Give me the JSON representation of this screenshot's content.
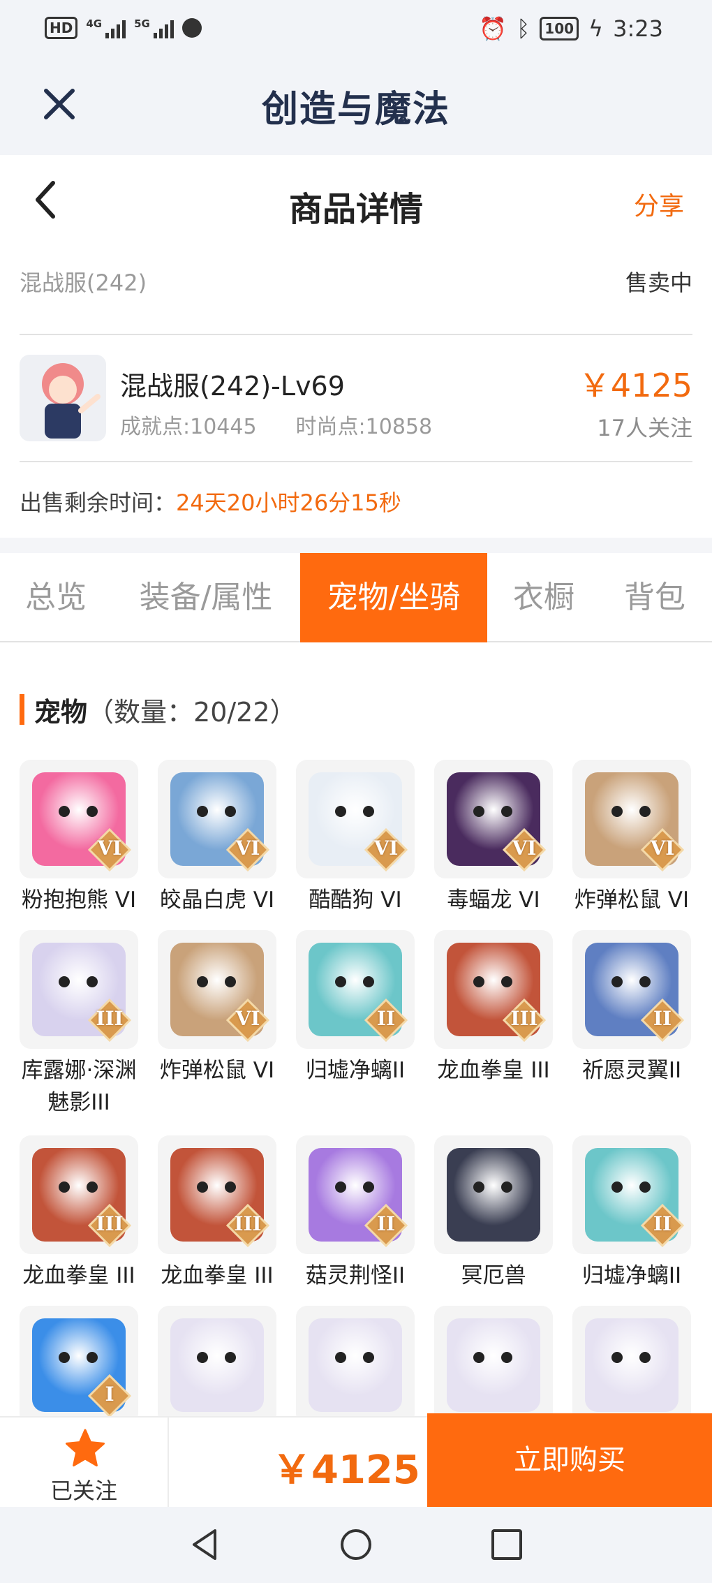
{
  "status_bar": {
    "hd_label": "HD",
    "net1": "4G",
    "net2": "5G",
    "battery": "100",
    "time": "3:23"
  },
  "app": {
    "title": "创造与魔法"
  },
  "header": {
    "title": "商品详情",
    "share_label": "分享"
  },
  "listing": {
    "server": "混战服(242)",
    "status": "售卖中",
    "character_name": "混战服(242)-Lv69",
    "achievement": "成就点:10445",
    "fashion": "时尚点:10858",
    "price": "￥4125",
    "followers": "17人关注",
    "time_label": "出售剩余时间：",
    "time_value": "24天20小时26分15秒"
  },
  "tabs": [
    {
      "label": "总览"
    },
    {
      "label": "装备/属性"
    },
    {
      "label": "宠物/坐骑"
    },
    {
      "label": "衣橱"
    },
    {
      "label": "背包"
    }
  ],
  "active_tab": "宠物/坐骑",
  "section": {
    "title": "宠物",
    "count": "（数量：20/22）"
  },
  "pets": [
    {
      "name": "粉抱抱熊 VI",
      "tier": "VI",
      "color": "#f36aa0"
    },
    {
      "name": "皎晶白虎 VI",
      "tier": "VI",
      "color": "#7aa7d6"
    },
    {
      "name": "酷酷狗 VI",
      "tier": "VI",
      "color": "#e8eef5"
    },
    {
      "name": "毒蝠龙 VI",
      "tier": "VI",
      "color": "#4a2b5e"
    },
    {
      "name": "炸弹松鼠 VI",
      "tier": "VI",
      "color": "#c9a27a"
    },
    {
      "name": "库露娜·深渊魅影III",
      "tier": "III",
      "color": "#d8d2ee"
    },
    {
      "name": "炸弹松鼠 VI",
      "tier": "VI",
      "color": "#c9a27a"
    },
    {
      "name": "归墟净螭II",
      "tier": "II",
      "color": "#6cc6c9"
    },
    {
      "name": "龙血拳皇 III",
      "tier": "III",
      "color": "#c2543a"
    },
    {
      "name": "祈愿灵翼II",
      "tier": "II",
      "color": "#5f7fc2"
    },
    {
      "name": "龙血拳皇 III",
      "tier": "III",
      "color": "#c2543a"
    },
    {
      "name": "龙血拳皇 III",
      "tier": "III",
      "color": "#c2543a"
    },
    {
      "name": "菇灵荆怪II",
      "tier": "II",
      "color": "#a77ae0"
    },
    {
      "name": "冥厄兽",
      "tier": "",
      "color": "#3a3e52"
    },
    {
      "name": "归墟净螭II",
      "tier": "II",
      "color": "#6cc6c9"
    },
    {
      "name": "",
      "tier": "I",
      "color": "#3b8ee8"
    },
    {
      "name": "",
      "tier": "",
      "color": "#e6e2f2"
    },
    {
      "name": "",
      "tier": "",
      "color": "#e6e2f2"
    },
    {
      "name": "",
      "tier": "",
      "color": "#e6e2f2"
    },
    {
      "name": "",
      "tier": "",
      "color": "#e6e2f2"
    }
  ],
  "bottom_bar": {
    "follow_label": "已关注",
    "total_price": "￥4125",
    "buy_label": "立即购买"
  },
  "colors": {
    "accent": "#ff6a0f",
    "price": "#f26a0f",
    "title": "#23304d"
  }
}
